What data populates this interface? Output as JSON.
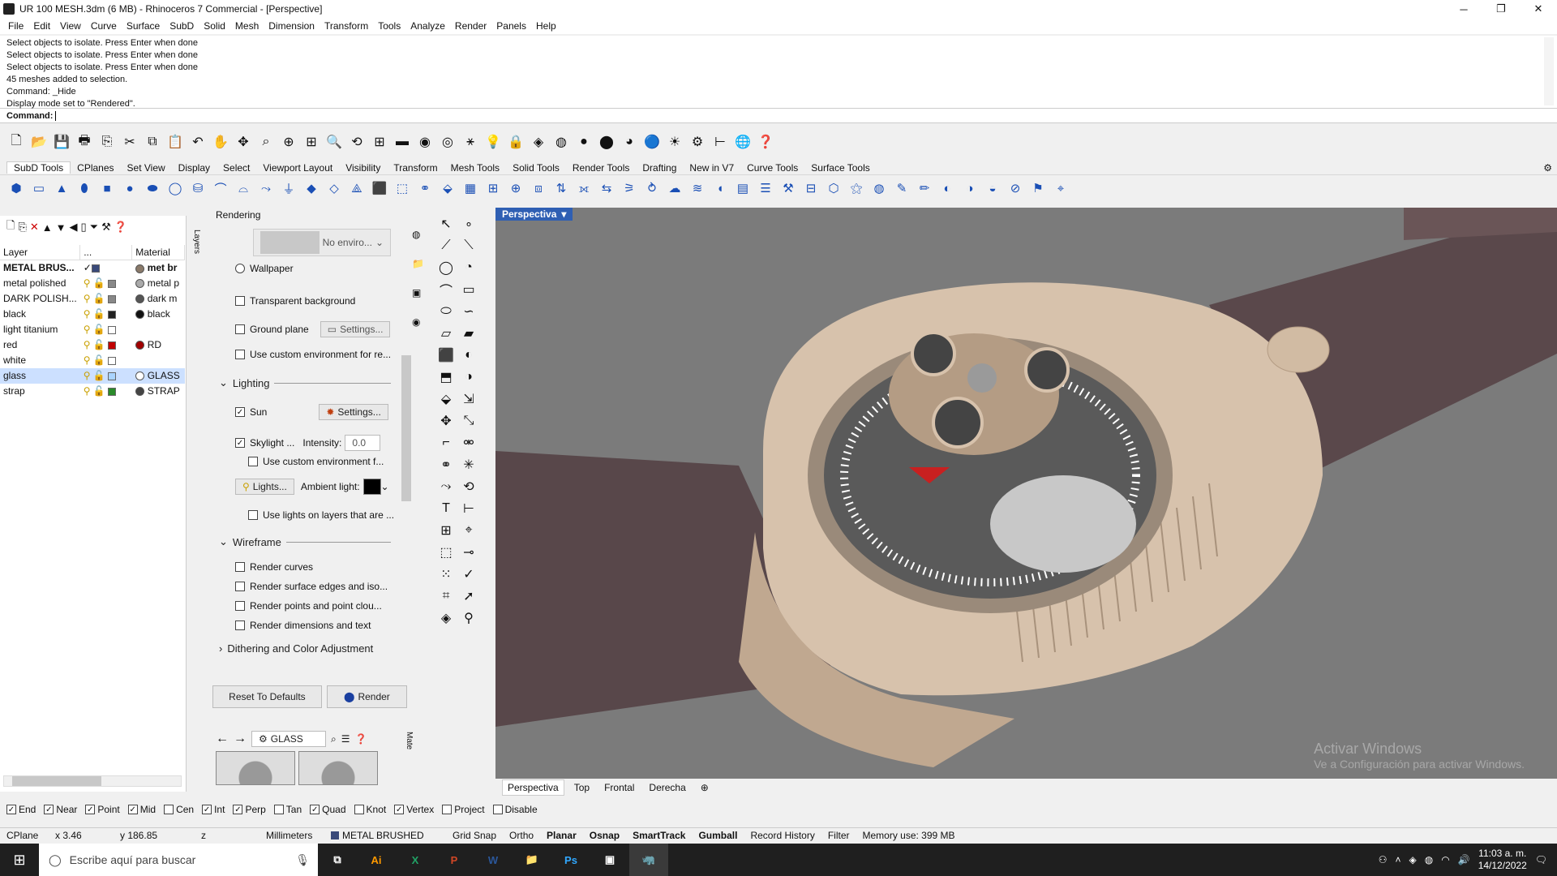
{
  "window": {
    "title": "UR 100 MESH.3dm (6 MB) - Rhinoceros 7 Commercial - [Perspective]",
    "minimize": "─",
    "maximize": "❐",
    "close": "✕"
  },
  "menu": [
    "File",
    "Edit",
    "View",
    "Curve",
    "Surface",
    "SubD",
    "Solid",
    "Mesh",
    "Dimension",
    "Transform",
    "Tools",
    "Analyze",
    "Render",
    "Panels",
    "Help"
  ],
  "command_history": [
    "Select objects to isolate. Press Enter when done",
    "Select objects to isolate. Press Enter when done",
    "Select objects to isolate. Press Enter when done",
    "45 meshes added to selection.",
    "Command: _Hide",
    "Display mode set to \"Rendered\"."
  ],
  "command_prompt": "Command:",
  "toolbar_tabs": [
    "SubD Tools",
    "CPlanes",
    "Set View",
    "Display",
    "Select",
    "Viewport Layout",
    "Visibility",
    "Transform",
    "Mesh Tools",
    "Solid Tools",
    "Render Tools",
    "Drafting",
    "New in V7",
    "Curve Tools",
    "Surface Tools"
  ],
  "layers": {
    "tab_label": "Layers",
    "headers": {
      "layer": "Layer",
      "more": "...",
      "material": "Material"
    },
    "rows": [
      {
        "name": "METAL BRUS...",
        "current": "✓",
        "color": "#3a4a7a",
        "material": "met br",
        "mcolor": "#8a7a6a",
        "bold": true
      },
      {
        "name": "metal polished",
        "current": "",
        "color": "#888888",
        "material": "metal p",
        "mcolor": "#aaaaaa"
      },
      {
        "name": "DARK POLISH...",
        "current": "",
        "color": "#888888",
        "material": "dark m",
        "mcolor": "#555555"
      },
      {
        "name": "black",
        "current": "",
        "color": "#222222",
        "material": "black",
        "mcolor": "#111111"
      },
      {
        "name": "light titanium",
        "current": "",
        "color": "#ffffff",
        "material": "",
        "mcolor": ""
      },
      {
        "name": "red",
        "current": "",
        "color": "#c00000",
        "material": "RD",
        "mcolor": "#a00000"
      },
      {
        "name": "white",
        "current": "",
        "color": "#ffffff",
        "material": "",
        "mcolor": ""
      },
      {
        "name": "glass",
        "current": "",
        "color": "#aad4ff",
        "material": "GLASS",
        "mcolor": "#ffffff",
        "selected": true
      },
      {
        "name": "strap",
        "current": "",
        "color": "#2a8a2a",
        "material": "STRAP",
        "mcolor": "#444444"
      }
    ]
  },
  "rendering": {
    "panel_title": "Rendering",
    "env_label": "No enviro...",
    "wallpaper": "Wallpaper",
    "transparent_bg": "Transparent background",
    "ground_plane": "Ground plane",
    "settings": "Settings...",
    "custom_env_reflections": "Use custom environment for re...",
    "lighting_title": "Lighting",
    "sun": "Sun",
    "skylight": "Skylight ...",
    "intensity_label": "Intensity:",
    "intensity_value": "0.0",
    "custom_env_f": "Use custom environment f...",
    "lights_btn": "Lights...",
    "ambient_label": "Ambient light:",
    "lights_on_layers": "Use lights on layers that are ...",
    "wireframe_title": "Wireframe",
    "render_curves": "Render curves",
    "render_surface_edges": "Render surface edges and iso...",
    "render_points": "Render points and point clou...",
    "render_dimensions": "Render dimensions and text",
    "dithering_title": "Dithering and Color Adjustment",
    "reset_btn": "Reset To Defaults",
    "render_btn": "Render"
  },
  "materials": {
    "search_value": "GLASS",
    "tab_label": "Mate"
  },
  "viewport": {
    "label": "Perspectiva",
    "watermark_title": "Activar Windows",
    "watermark_sub": "Ve a Configuración para activar Windows."
  },
  "view_tabs": [
    "Perspectiva",
    "Top",
    "Frontal",
    "Derecha"
  ],
  "osnaps": [
    {
      "label": "End",
      "checked": true
    },
    {
      "label": "Near",
      "checked": true
    },
    {
      "label": "Point",
      "checked": true
    },
    {
      "label": "Mid",
      "checked": true
    },
    {
      "label": "Cen",
      "checked": false
    },
    {
      "label": "Int",
      "checked": true
    },
    {
      "label": "Perp",
      "checked": true
    },
    {
      "label": "Tan",
      "checked": false
    },
    {
      "label": "Quad",
      "checked": true
    },
    {
      "label": "Knot",
      "checked": false
    },
    {
      "label": "Vertex",
      "checked": true
    },
    {
      "label": "Project",
      "checked": false
    },
    {
      "label": "Disable",
      "checked": false
    }
  ],
  "status": {
    "cplane": "CPlane",
    "x": "x 3.46",
    "y": "y 186.85",
    "z": "z",
    "units": "Millimeters",
    "layer": "METAL BRUSHED",
    "grid_snap": "Grid Snap",
    "ortho": "Ortho",
    "planar": "Planar",
    "osnap": "Osnap",
    "smarttrack": "SmartTrack",
    "gumball": "Gumball",
    "record_history": "Record History",
    "filter": "Filter",
    "memory": "Memory use: 399 MB"
  },
  "taskbar": {
    "search_placeholder": "Escribe aquí para buscar",
    "time": "11:03 a. m.",
    "date": "14/12/2022"
  },
  "colors": {
    "viewport_bg": "#7b7b7b",
    "case": "#d7c2ac",
    "strap": "#58474a",
    "dial": "#555555",
    "accent_red": "#c82020",
    "selection": "#cce0ff",
    "viewport_label_bg": "#2f5fb3"
  }
}
